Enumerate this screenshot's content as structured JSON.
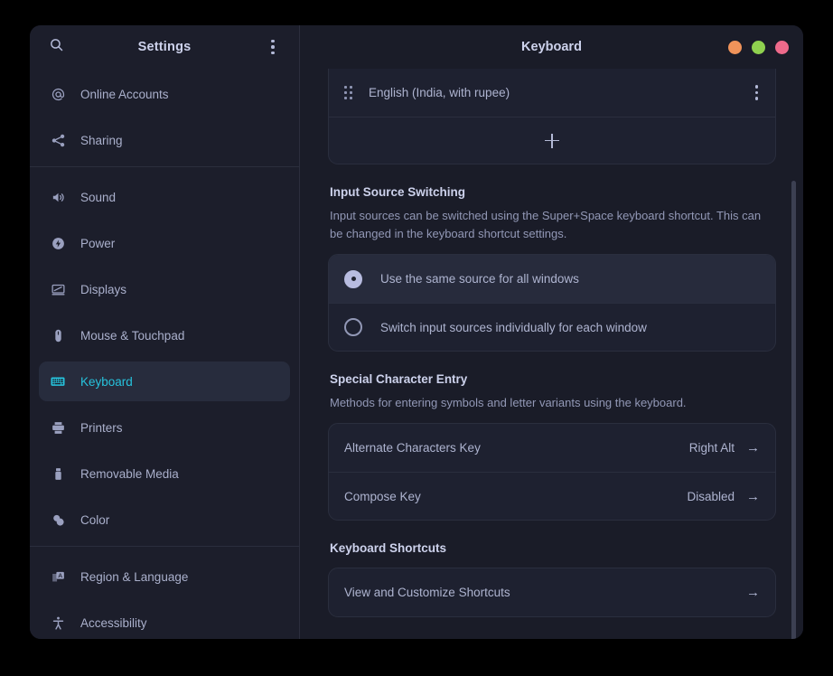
{
  "sidebar": {
    "title": "Settings",
    "search_icon": "search-icon",
    "menu_icon": "more-options-icon",
    "items": [
      {
        "label": "Online Accounts",
        "icon": "at-sign-icon",
        "selected": false,
        "divider_after": false
      },
      {
        "label": "Sharing",
        "icon": "share-nodes-icon",
        "selected": false,
        "divider_after": true
      },
      {
        "label": "Sound",
        "icon": "speaker-icon",
        "selected": false,
        "divider_after": false
      },
      {
        "label": "Power",
        "icon": "power-bolt-icon",
        "selected": false,
        "divider_after": false
      },
      {
        "label": "Displays",
        "icon": "display-icon",
        "selected": false,
        "divider_after": false
      },
      {
        "label": "Mouse & Touchpad",
        "icon": "mouse-icon",
        "selected": false,
        "divider_after": false
      },
      {
        "label": "Keyboard",
        "icon": "keyboard-icon",
        "selected": true,
        "divider_after": false
      },
      {
        "label": "Printers",
        "icon": "printer-icon",
        "selected": false,
        "divider_after": false
      },
      {
        "label": "Removable Media",
        "icon": "usb-drive-icon",
        "selected": false,
        "divider_after": false
      },
      {
        "label": "Color",
        "icon": "color-circles-icon",
        "selected": false,
        "divider_after": true
      },
      {
        "label": "Region & Language",
        "icon": "language-icon",
        "selected": false,
        "divider_after": false
      },
      {
        "label": "Accessibility",
        "icon": "accessibility-icon",
        "selected": false,
        "divider_after": false
      }
    ]
  },
  "content": {
    "title": "Keyboard",
    "window_controls": [
      {
        "name": "minimize-button",
        "color": "#f0935a"
      },
      {
        "name": "maximize-button",
        "color": "#8fd14f"
      },
      {
        "name": "close-button",
        "color": "#ee6a8b"
      }
    ],
    "input_sources": {
      "items": [
        {
          "label": "English (India, with rupee)",
          "drag_icon": "drag-handle-icon",
          "menu_icon": "more-options-icon"
        }
      ],
      "add_icon": "plus-icon"
    },
    "input_source_switching": {
      "title": "Input Source Switching",
      "description": "Input sources can be switched using the Super+Space keyboard shortcut. This can be changed in the keyboard shortcut settings.",
      "options": [
        {
          "label": "Use the same source for all windows",
          "selected": true
        },
        {
          "label": "Switch input sources individually for each window",
          "selected": false
        }
      ]
    },
    "special_character_entry": {
      "title": "Special Character Entry",
      "description": "Methods for entering symbols and letter variants using the keyboard.",
      "rows": [
        {
          "label": "Alternate Characters Key",
          "value": "Right Alt",
          "arrow": "→"
        },
        {
          "label": "Compose Key",
          "value": "Disabled",
          "arrow": "→"
        }
      ]
    },
    "keyboard_shortcuts": {
      "title": "Keyboard Shortcuts",
      "rows": [
        {
          "label": "View and Customize Shortcuts",
          "arrow": "→"
        }
      ]
    }
  },
  "colors": {
    "accent": "#27c3dd",
    "window_bg": "#1a1c28",
    "sidebar_bg": "#1c1e2b",
    "card_bg": "#1e2130"
  }
}
